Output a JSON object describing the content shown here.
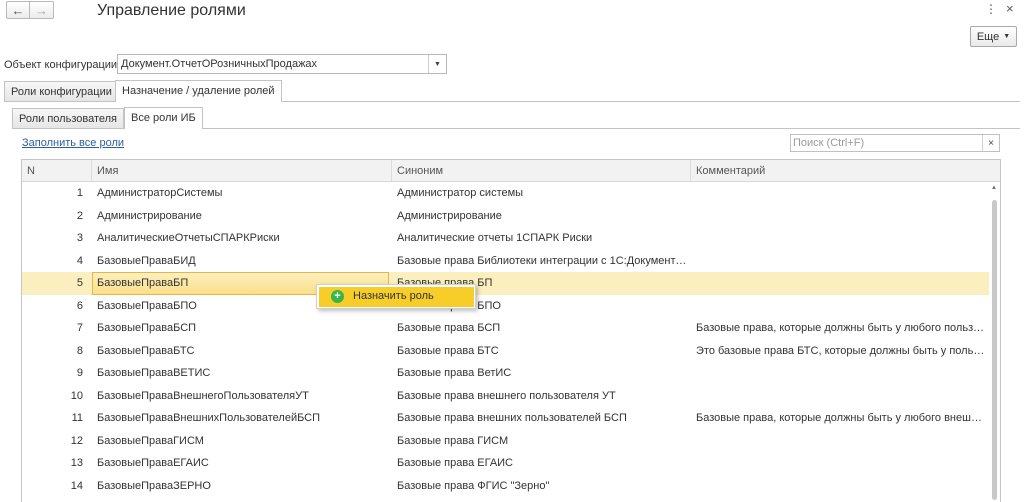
{
  "toolbar": {
    "back_icon": "←",
    "forward_icon": "→",
    "title": "Управление ролями",
    "kebab_icon": "⋮",
    "close_icon": "×",
    "more_label": "Еще"
  },
  "config_object": {
    "label": "Объект конфигурации:",
    "value": "Документ.ОтчетОРозничныхПродажах"
  },
  "outer_tabs": [
    {
      "label": "Роли конфигурации",
      "active": false
    },
    {
      "label": "Назначение / удаление ролей",
      "active": true
    }
  ],
  "inner_tabs": [
    {
      "label": "Роли пользователя",
      "active": false
    },
    {
      "label": "Все роли ИБ",
      "active": true
    }
  ],
  "fill_link": "Заполнить все роли",
  "search": {
    "placeholder": "Поиск (Ctrl+F)",
    "clear_icon": "×"
  },
  "table": {
    "columns": [
      "N",
      "Имя",
      "Синоним",
      "Комментарий"
    ],
    "selected_row": 5,
    "rows": [
      {
        "n": "1",
        "name": "АдминистраторСистемы",
        "synonym": "Администратор системы",
        "comment": ""
      },
      {
        "n": "2",
        "name": "Администрирование",
        "synonym": "Администрирование",
        "comment": ""
      },
      {
        "n": "3",
        "name": "АналитическиеОтчетыСПАРКРиски",
        "synonym": "Аналитические отчеты 1СПАРК Риски",
        "comment": ""
      },
      {
        "n": "4",
        "name": "БазовыеПраваБИД",
        "synonym": "Базовые права Библиотеки интеграции с 1С:Документо…",
        "comment": ""
      },
      {
        "n": "5",
        "name": "БазовыеПраваБП",
        "synonym": "Базовые права БП",
        "comment": ""
      },
      {
        "n": "6",
        "name": "БазовыеПраваБПО",
        "synonym": "Базовые права БПО",
        "comment": ""
      },
      {
        "n": "7",
        "name": "БазовыеПраваБСП",
        "synonym": "Базовые права БСП",
        "comment": "Базовые права, которые должны быть у любого пользо…"
      },
      {
        "n": "8",
        "name": "БазовыеПраваБТС",
        "synonym": "Базовые права БТС",
        "comment": "Это базовые права БТС, которые должны быть у польз…"
      },
      {
        "n": "9",
        "name": "БазовыеПраваВЕТИС",
        "synonym": "Базовые права ВетИС",
        "comment": ""
      },
      {
        "n": "10",
        "name": "БазовыеПраваВнешнегоПользователяУТ",
        "synonym": "Базовые права внешнего пользователя УТ",
        "comment": ""
      },
      {
        "n": "11",
        "name": "БазовыеПраваВнешнихПользователейБСП",
        "synonym": "Базовые права внешних пользователей БСП",
        "comment": "Базовые права, которые должны быть у любого внешн…"
      },
      {
        "n": "12",
        "name": "БазовыеПраваГИСМ",
        "synonym": "Базовые права ГИСМ",
        "comment": ""
      },
      {
        "n": "13",
        "name": "БазовыеПраваЕГАИС",
        "synonym": "Базовые права ЕГАИС",
        "comment": ""
      },
      {
        "n": "14",
        "name": "БазовыеПраваЗЕРНО",
        "synonym": "Базовые права ФГИС \"Зерно\"",
        "comment": ""
      },
      {
        "n": "15",
        "name": "",
        "synonym": "",
        "comment": ""
      }
    ]
  },
  "context_menu": {
    "item_label": "Назначить роль",
    "icon": "+"
  },
  "colors": {
    "selection": "#fbefc0",
    "menu_highlight": "#f7cd2a",
    "link": "#2d5f9b"
  }
}
